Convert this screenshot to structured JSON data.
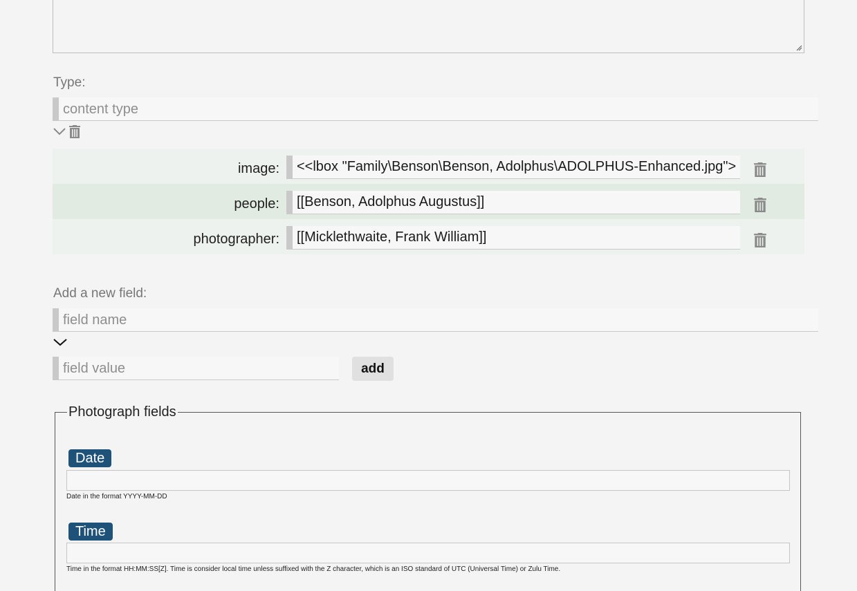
{
  "type_section": {
    "label": "Type:",
    "placeholder": "content type"
  },
  "fields": [
    {
      "key": "image:",
      "value": "<<lbox \"Family\\Benson\\Benson, Adolphus\\ADOLPHUS-Enhanced.jpg\">"
    },
    {
      "key": "people:",
      "value": "[[Benson, Adolphus Augustus]]"
    },
    {
      "key": "photographer:",
      "value": "[[Micklethwaite, Frank William]]"
    }
  ],
  "new_field": {
    "label": "Add a new field:",
    "name_placeholder": "field name",
    "value_placeholder": "field value",
    "add_label": "add"
  },
  "photograph_fields": {
    "legend": "Photograph fields",
    "date": {
      "label": "Date",
      "help": "Date in the format YYYY-MM-DD"
    },
    "time": {
      "label": "Time",
      "help": "Time in the format HH:MM:SS[Z]. Time is consider local time unless suffixed with the Z character, which is an ISO standard of UTC (Universal Time) or Zulu Time."
    }
  },
  "colors": {
    "background": "#f4f4f4",
    "row_odd": "#edf2ee",
    "row_even": "#e2ebe2",
    "badge": "#1f5278",
    "icon": "#8a8a8a"
  },
  "icons": {
    "chevron": "chevron-down-icon",
    "trash": "trash-icon",
    "resize": "resize-grip-icon"
  }
}
